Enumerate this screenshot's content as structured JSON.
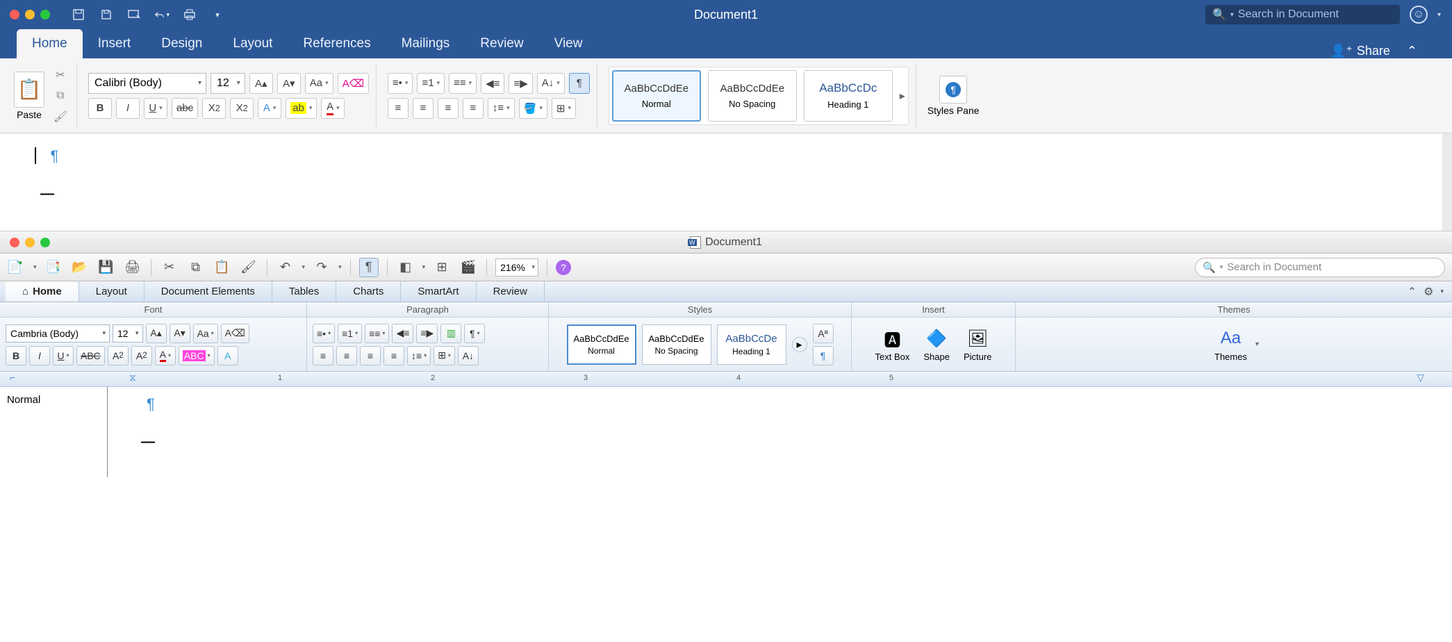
{
  "w1": {
    "title": "Document1",
    "search_placeholder": "Search in Document",
    "share_label": "Share",
    "tabs": [
      "Home",
      "Insert",
      "Design",
      "Layout",
      "References",
      "Mailings",
      "Review",
      "View"
    ],
    "active_tab": "Home",
    "paste_label": "Paste",
    "font_name": "Calibri (Body)",
    "font_size": "12",
    "styles": [
      {
        "preview": "AaBbCcDdEe",
        "name": "Normal",
        "selected": true,
        "color": "#333"
      },
      {
        "preview": "AaBbCcDdEe",
        "name": "No Spacing",
        "selected": false,
        "color": "#333"
      },
      {
        "preview": "AaBbCcDc",
        "name": "Heading 1",
        "selected": false,
        "color": "#2b5797"
      }
    ],
    "styles_pane": "Styles Pane"
  },
  "w2": {
    "title": "Document1",
    "zoom": "216%",
    "search_placeholder": "Search in Document",
    "tabs": [
      "Home",
      "Layout",
      "Document Elements",
      "Tables",
      "Charts",
      "SmartArt",
      "Review"
    ],
    "active_tab": "Home",
    "group_labels": [
      "Font",
      "Paragraph",
      "Styles",
      "Insert",
      "Themes"
    ],
    "font_name": "Cambria (Body)",
    "font_size": "12",
    "styles": [
      {
        "preview": "AaBbCcDdEe",
        "name": "Normal",
        "selected": true,
        "color": "#333"
      },
      {
        "preview": "AaBbCcDdEe",
        "name": "No Spacing",
        "selected": false,
        "color": "#333"
      },
      {
        "preview": "AaBbCcDe",
        "name": "Heading 1",
        "selected": false,
        "color": "#2b5797"
      }
    ],
    "insert_items": [
      "Text Box",
      "Shape",
      "Picture",
      "Themes"
    ],
    "ruler_marks": [
      "1",
      "2",
      "3",
      "4",
      "5"
    ],
    "style_area": "Normal"
  }
}
